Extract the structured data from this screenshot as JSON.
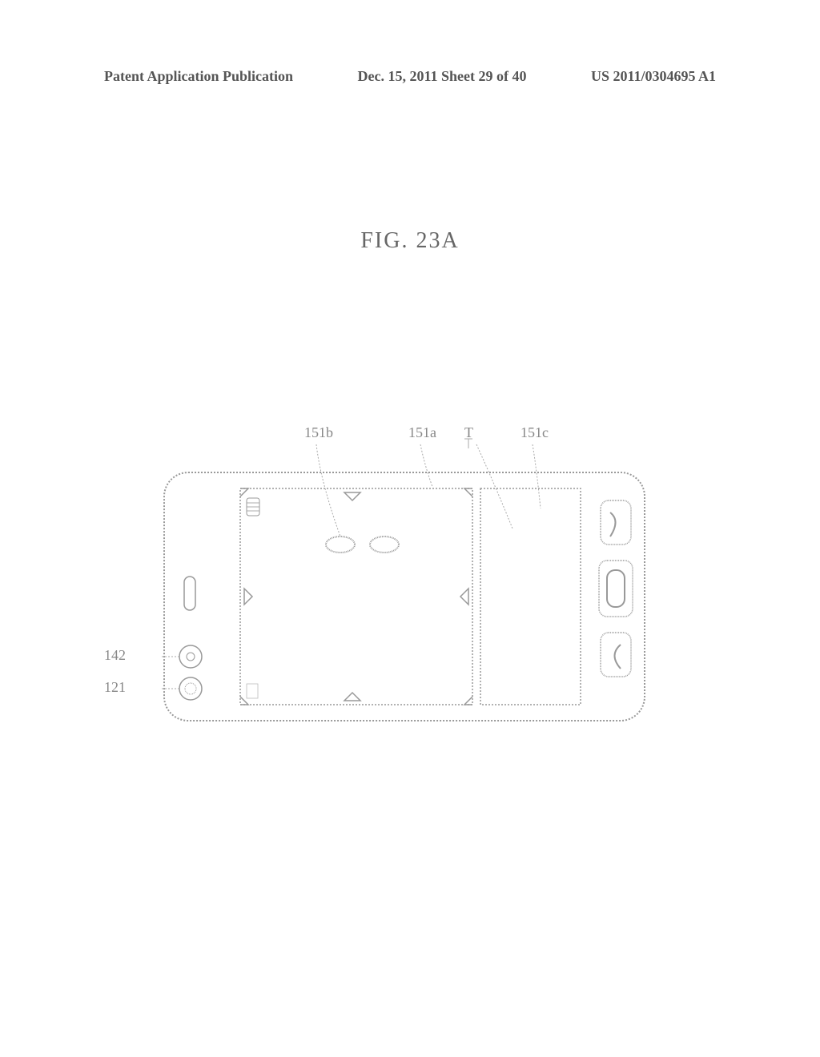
{
  "header": {
    "left": "Patent Application Publication",
    "center": "Dec. 15, 2011  Sheet 29 of 40",
    "right": "US 2011/0304695 A1"
  },
  "figure": {
    "label": "FIG. 23A"
  },
  "refs": {
    "r151b": "151b",
    "r151a": "151a",
    "rT": "T",
    "r151c": "151c",
    "r142": "142",
    "r121": "121"
  }
}
